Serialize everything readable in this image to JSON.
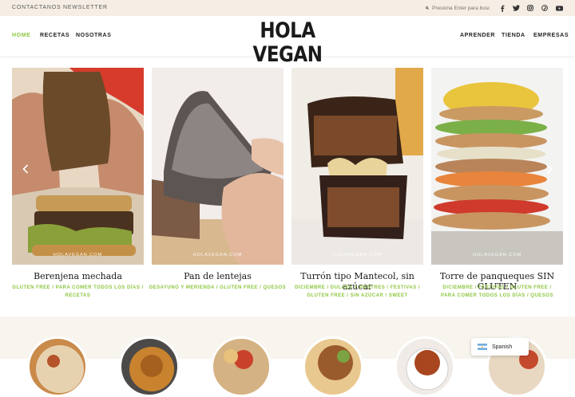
{
  "topbar": {
    "links": [
      "CONTACTANOS",
      "NEWSLETTER"
    ],
    "search_placeholder": "Presiona Enter para buscar",
    "social": [
      "facebook-icon",
      "twitter-icon",
      "instagram-icon",
      "pinterest-icon",
      "youtube-icon"
    ]
  },
  "header": {
    "logo": "HOLA VEGAN",
    "nav_left": [
      "HOME",
      "RECETAS",
      "NOSOTRAS"
    ],
    "nav_right": [
      "APRENDER",
      "TIENDA",
      "EMPRESAS"
    ]
  },
  "slider": {
    "watermark": "HOLAVEGAN.COM",
    "cards": [
      {
        "title": "Berenjena mechada",
        "tags": [
          "GLUTEN FREE / PARA COMER TODOS LOS DÍAS /",
          "RECETAS"
        ]
      },
      {
        "title": "Pan de lentejas",
        "tags": [
          "DESAYUNO Y MERIENDA / GLUTEN FREE / QUESOS"
        ]
      },
      {
        "title": "Turrón tipo Mantecol, sin azúcar",
        "tags": [
          "DICIEMBRE / DULCES Y POSTRES / FESTIVAS /",
          "GLUTEN FREE / SIN AZÚCAR / SWEET"
        ]
      },
      {
        "title": "Torre de panqueques SIN GLUTEN",
        "tags": [
          "DICIEMBRE / FESTIVAS / GLUTEN FREE /",
          "PARA COMER TODOS LOS DÍAS / QUESOS"
        ]
      }
    ]
  },
  "language": {
    "label": "Spanish"
  },
  "colors": {
    "accent": "#8cc63f",
    "topbar_bg": "#f6eee4",
    "bottom_bg": "#f8f4ee"
  }
}
